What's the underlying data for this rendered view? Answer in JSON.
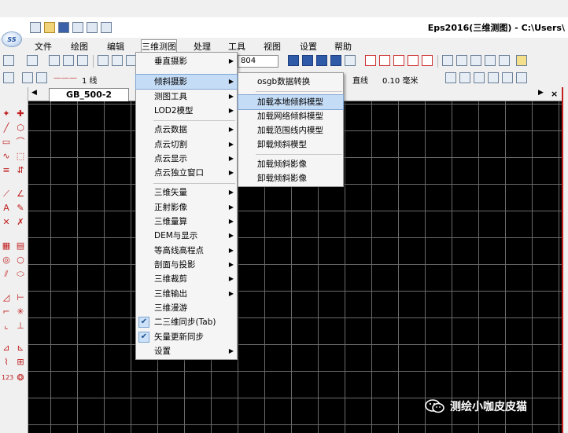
{
  "window": {
    "title": "Eps2016(三维测图) -  C:\\Users\\"
  },
  "menubar": [
    "文件",
    "绘图",
    "编辑",
    "三维测图",
    "处理",
    "工具",
    "视图",
    "设置",
    "帮助"
  ],
  "toolbar": {
    "scale_combo": "804",
    "linewidth_label": "1 线",
    "linetype_label": "直线",
    "linewidth_value": "0.10 毫米"
  },
  "document_tab": "GB_500-2",
  "dropdown": {
    "items": [
      {
        "label": "垂直摄影",
        "submenu": true
      },
      {
        "label": "倾斜摄影",
        "submenu": true,
        "highlighted": true
      },
      {
        "label": "测图工具",
        "submenu": true
      },
      {
        "label": "LOD2模型",
        "submenu": true
      },
      {
        "label": "点云数据",
        "submenu": true
      },
      {
        "label": "点云切割",
        "submenu": true
      },
      {
        "label": "点云显示",
        "submenu": true
      },
      {
        "label": "点云独立窗口",
        "submenu": true
      },
      {
        "label": "三维矢量",
        "submenu": true
      },
      {
        "label": "正射影像",
        "submenu": true
      },
      {
        "label": "三维量算",
        "submenu": true
      },
      {
        "label": "DEM与显示",
        "submenu": true
      },
      {
        "label": "等高线高程点",
        "submenu": true
      },
      {
        "label": "剖面与投影",
        "submenu": true
      },
      {
        "label": "三维裁剪",
        "submenu": true
      },
      {
        "label": "三维输出",
        "submenu": true
      },
      {
        "label": "三维漫游",
        "submenu": false
      },
      {
        "label": "二三维同步(Tab)",
        "submenu": false,
        "checked": true
      },
      {
        "label": "矢量更新同步",
        "submenu": false,
        "checked": true
      },
      {
        "label": "设置",
        "submenu": true
      }
    ]
  },
  "submenu": {
    "items": [
      {
        "label": "osgb数据转换"
      },
      {
        "label": "加载本地倾斜模型",
        "highlighted": true
      },
      {
        "label": "加载网络倾斜模型"
      },
      {
        "label": "加载范围线内模型"
      },
      {
        "label": "卸载倾斜模型"
      },
      {
        "label": "加载倾斜影像"
      },
      {
        "label": "卸载倾斜影像"
      }
    ]
  },
  "watermark": "测绘小咖皮皮猫",
  "colors": {
    "canvas": "#000000",
    "grid": "#6a6a6a",
    "highlight": "#c5dcf6"
  }
}
